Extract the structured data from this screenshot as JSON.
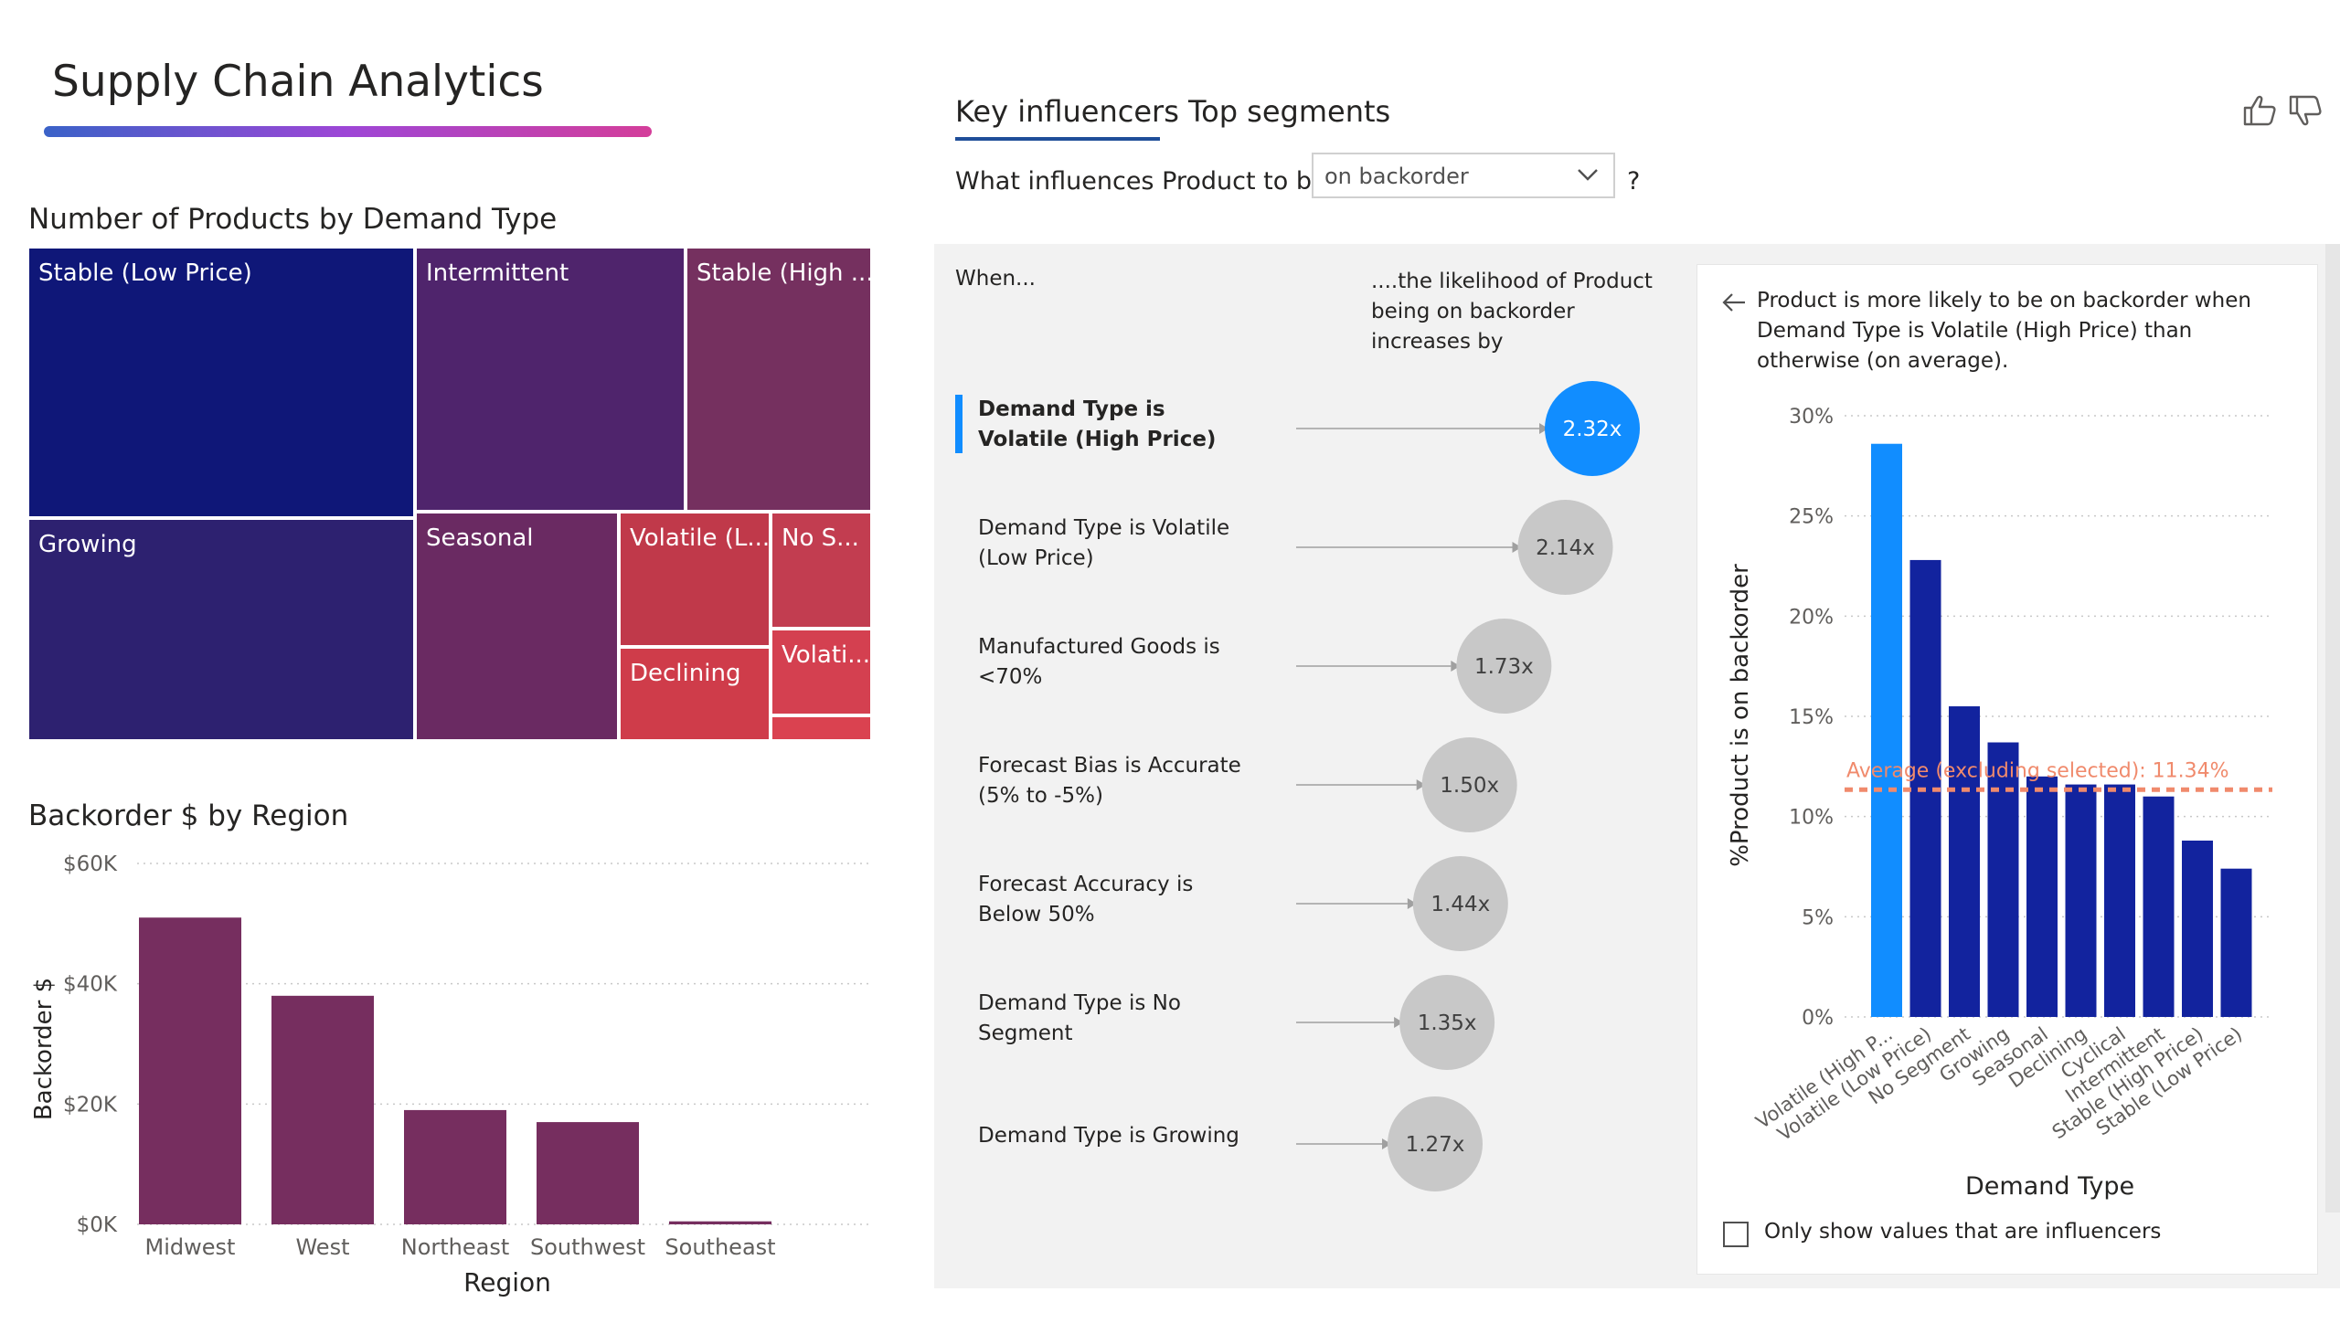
{
  "title": "Supply Chain Analytics",
  "treemap": {
    "title": "Number of Products by Demand Type",
    "tiles": [
      {
        "label": "Stable (Low Price)",
        "color": "#0f1778"
      },
      {
        "label": "Intermittent",
        "color": "#4f246c"
      },
      {
        "label": "Stable (High ...",
        "color": "#75305f"
      },
      {
        "label": "Growing",
        "color": "#2d2170"
      },
      {
        "label": "Seasonal",
        "color": "#6a2a62"
      },
      {
        "label": "Volatile (L...",
        "color": "#c0394a"
      },
      {
        "label": "No S...",
        "color": "#c23d50"
      },
      {
        "label": "Declining",
        "color": "#cf3c4a"
      },
      {
        "label": "Volati...",
        "color": "#d44050"
      },
      {
        "label": "",
        "color": "#da4250"
      }
    ]
  },
  "backorder_chart": {
    "title": "Backorder $ by Region",
    "chart_data": {
      "type": "bar",
      "categories": [
        "Midwest",
        "West",
        "Northeast",
        "Southwest",
        "Southeast"
      ],
      "values": [
        51000,
        38000,
        19000,
        17000,
        500
      ],
      "xlabel": "Region",
      "ylabel": "Backorder $",
      "ylim": [
        0,
        60000
      ],
      "yticks": [
        "$0K",
        "$20K",
        "$40K",
        "$60K"
      ],
      "ytick_values": [
        0,
        20000,
        40000,
        60000
      ],
      "color": "#762e5f",
      "grid": true
    }
  },
  "key_influencers": {
    "tabs": [
      "Key influencers",
      "Top segments"
    ],
    "question": "What influences Product to be",
    "dropdown_value": "on backorder",
    "question_mark": "?",
    "when": "When...",
    "likelihood": "....the likelihood of Product being on backorder increases by",
    "items": [
      {
        "label": "Demand Type is Volatile (High Price)",
        "value": 2.32,
        "text": "2.32x",
        "selected": true
      },
      {
        "label": "Demand Type is Volatile (Low Price)",
        "value": 2.14,
        "text": "2.14x",
        "selected": false
      },
      {
        "label": "Manufactured Goods is <70%",
        "value": 1.73,
        "text": "1.73x",
        "selected": false
      },
      {
        "label": "Forecast Bias is Accurate (5% to -5%)",
        "value": 1.5,
        "text": "1.50x",
        "selected": false
      },
      {
        "label": "Forecast Accuracy is Below 50%",
        "value": 1.44,
        "text": "1.44x",
        "selected": false
      },
      {
        "label": "Demand Type is No Segment",
        "value": 1.35,
        "text": "1.35x",
        "selected": false
      },
      {
        "label": "Demand Type is Growing",
        "value": 1.27,
        "text": "1.27x",
        "selected": false
      }
    ],
    "selected_color": "#118dff",
    "bubble_color": "#c8c8c8"
  },
  "detail": {
    "text": "Product is more likely to be on backorder when Demand Type is Volatile (High Price) than otherwise (on average).",
    "checkbox_label": "Only show values that are influencers",
    "chart_data": {
      "type": "bar",
      "categories": [
        "Volatile (High P...",
        "Volatile (Low Price)",
        "No Segment",
        "Growing",
        "Seasonal",
        "Declining",
        "Cyclical",
        "Intermittent",
        "Stable (High Price)",
        "Stable (Low Price)"
      ],
      "values": [
        28.6,
        22.8,
        15.5,
        13.7,
        12.0,
        11.6,
        11.6,
        11.0,
        8.8,
        7.4
      ],
      "highlight_index": 0,
      "highlight_color": "#118dff",
      "bar_color": "#12239e",
      "xlabel": "Demand Type",
      "ylabel": "%Product is on backorder",
      "ylim": [
        0,
        30
      ],
      "yticks": [
        "0%",
        "5%",
        "10%",
        "15%",
        "20%",
        "25%",
        "30%"
      ],
      "ytick_values": [
        0,
        5,
        10,
        15,
        20,
        25,
        30
      ],
      "average": 11.34,
      "average_label": "Average (excluding selected): 11.34%",
      "average_color": "#f08a6c"
    }
  }
}
